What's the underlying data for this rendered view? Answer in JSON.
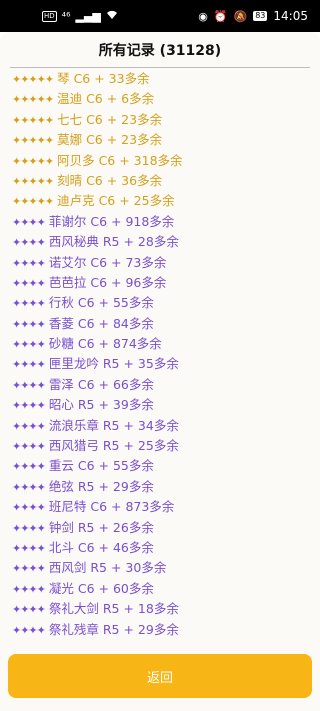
{
  "status_bar": {
    "left_icons": [
      "HD",
      "⁴⁶",
      "▂▄▆",
      "wifi"
    ],
    "battery": "83",
    "time": "14:05"
  },
  "page": {
    "title": "所有记录 (31128)",
    "back_label": "返回"
  },
  "colors": {
    "five_star": "#d4a11e",
    "four_star": "#7a4fd0",
    "button": "#f7b516"
  },
  "records": [
    {
      "stars": "✦✦✦✦✦",
      "text": "琴 C6 + 33多余",
      "rarity": 5
    },
    {
      "stars": "✦✦✦✦✦",
      "text": "温迪 C6 + 6多余",
      "rarity": 5
    },
    {
      "stars": "✦✦✦✦✦",
      "text": "七七 C6 + 23多余",
      "rarity": 5
    },
    {
      "stars": "✦✦✦✦✦",
      "text": "莫娜 C6 + 23多余",
      "rarity": 5
    },
    {
      "stars": "✦✦✦✦✦",
      "text": "阿贝多 C6 + 318多余",
      "rarity": 5
    },
    {
      "stars": "✦✦✦✦✦",
      "text": "刻晴 C6 + 36多余",
      "rarity": 5
    },
    {
      "stars": "✦✦✦✦✦",
      "text": "迪卢克 C6 + 25多余",
      "rarity": 5
    },
    {
      "stars": "✦✦✦✦",
      "text": "菲谢尔 C6 + 918多余",
      "rarity": 4
    },
    {
      "stars": "✦✦✦✦",
      "text": "西风秘典 R5 + 28多余",
      "rarity": 4
    },
    {
      "stars": "✦✦✦✦",
      "text": "诺艾尔 C6 + 73多余",
      "rarity": 4
    },
    {
      "stars": "✦✦✦✦",
      "text": "芭芭拉 C6 + 96多余",
      "rarity": 4
    },
    {
      "stars": "✦✦✦✦",
      "text": "行秋 C6 + 55多余",
      "rarity": 4
    },
    {
      "stars": "✦✦✦✦",
      "text": "香菱 C6 + 84多余",
      "rarity": 4
    },
    {
      "stars": "✦✦✦✦",
      "text": "砂糖 C6 + 874多余",
      "rarity": 4
    },
    {
      "stars": "✦✦✦✦",
      "text": "匣里龙吟 R5 + 35多余",
      "rarity": 4
    },
    {
      "stars": "✦✦✦✦",
      "text": "雷泽 C6 + 66多余",
      "rarity": 4
    },
    {
      "stars": "✦✦✦✦",
      "text": "昭心 R5 + 39多余",
      "rarity": 4
    },
    {
      "stars": "✦✦✦✦",
      "text": "流浪乐章 R5 + 34多余",
      "rarity": 4
    },
    {
      "stars": "✦✦✦✦",
      "text": "西风猎弓 R5 + 25多余",
      "rarity": 4
    },
    {
      "stars": "✦✦✦✦",
      "text": "重云 C6 + 55多余",
      "rarity": 4
    },
    {
      "stars": "✦✦✦✦",
      "text": "绝弦 R5 + 29多余",
      "rarity": 4
    },
    {
      "stars": "✦✦✦✦",
      "text": "班尼特 C6 + 873多余",
      "rarity": 4
    },
    {
      "stars": "✦✦✦✦",
      "text": "钟剑 R5 + 26多余",
      "rarity": 4
    },
    {
      "stars": "✦✦✦✦",
      "text": "北斗 C6 + 46多余",
      "rarity": 4
    },
    {
      "stars": "✦✦✦✦",
      "text": "西风剑 R5 + 30多余",
      "rarity": 4
    },
    {
      "stars": "✦✦✦✦",
      "text": "凝光 C6 + 60多余",
      "rarity": 4
    },
    {
      "stars": "✦✦✦✦",
      "text": "祭礼大剑 R5 + 18多余",
      "rarity": 4
    },
    {
      "stars": "✦✦✦✦",
      "text": "祭礼残章 R5 + 29多余",
      "rarity": 4
    }
  ]
}
